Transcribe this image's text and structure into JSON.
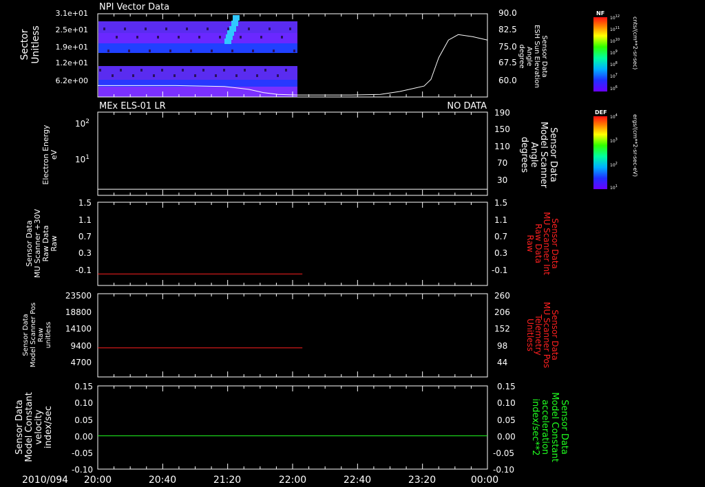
{
  "date_label": "2010/094",
  "time_ticks": [
    "20:00",
    "20:40",
    "21:20",
    "22:00",
    "22:40",
    "23:20",
    "00:00"
  ],
  "colorbars": [
    {
      "tag": "NF",
      "unit": "cnts/(cm**2-sr-sec)",
      "tick_exp": [
        "12",
        "11",
        "10",
        "9",
        "8",
        "7",
        "6"
      ]
    },
    {
      "tag": "DEF",
      "unit": "ergs/(cm**2-sr-sec-eV)",
      "tick_exp": [
        "4",
        "3",
        "2",
        "1"
      ]
    }
  ],
  "panel1": {
    "title": "NPI Vector Data",
    "left_label": [
      "Sector",
      "Unitless"
    ],
    "left_ticks": [
      "3.1e+01",
      "2.5e+01",
      "1.9e+01",
      "1.2e+01",
      "6.2e+00"
    ],
    "right_label": [
      "Sensor Data",
      "ESH Sun Elevation",
      "Angle",
      "degree"
    ],
    "right_ticks": [
      "90.0",
      "82.5",
      "75.0",
      "67.5",
      "60.0"
    ]
  },
  "panel2": {
    "title": "MEx ELS-01 LR",
    "status": "NO DATA",
    "left_label": [
      "Electron Energy",
      "eV"
    ],
    "left_ticks": [
      "10^2",
      "10^1"
    ],
    "right_label": [
      "Sensor Data",
      "Model Scanner",
      "Angle",
      "degrees"
    ],
    "right_ticks": [
      "190",
      "150",
      "110",
      "70",
      "30"
    ]
  },
  "panel3": {
    "left_label": [
      "Sensor Data",
      "MU Scanner +30V",
      "Raw Data",
      "Raw"
    ],
    "left_ticks": [
      "1.5",
      "1.1",
      "0.7",
      "0.3",
      "-0.1"
    ],
    "right_label": [
      "Sensor Data",
      "MU Scanner Int",
      "Raw Data",
      "Raw"
    ],
    "right_ticks": [
      "1.5",
      "1.1",
      "0.7",
      "0.3",
      "-0.1"
    ]
  },
  "panel4": {
    "left_label": [
      "Sensor Data",
      "Model Scanner Pos",
      "Raw",
      "unitless"
    ],
    "left_ticks": [
      "23500",
      "18800",
      "14100",
      "9400",
      "4700"
    ],
    "right_label": [
      "Sensor Data",
      "MU Scanner Pos",
      "Telemetry",
      "Unitless"
    ],
    "right_ticks": [
      "260",
      "206",
      "152",
      "98",
      "44"
    ]
  },
  "panel5": {
    "left_label": [
      "Sensor Data",
      "Model Constant",
      "velocity",
      "index/sec"
    ],
    "left_ticks": [
      "0.15",
      "0.10",
      "0.05",
      "0.00",
      "-0.05",
      "-0.10"
    ],
    "right_label": [
      "Sensor Data",
      "Model Constant",
      "acceleration",
      "index/sec**2"
    ],
    "right_ticks": [
      "0.15",
      "0.10",
      "0.05",
      "0.00",
      "-0.05",
      "-0.10"
    ]
  },
  "colors": {
    "white": "#ffffff",
    "red": "#ff2020",
    "green": "#20ff20",
    "bg": "#000000"
  },
  "chart_data": [
    {
      "type": "heatmap",
      "title": "NPI Vector Data",
      "xlabel": "",
      "x_range": [
        "20:00",
        "00:00"
      ],
      "data_extent": [
        "20:00",
        "22:03"
      ],
      "sector_rows_y_approx": [
        28.6,
        24.0,
        17.6,
        12.0,
        8.0
      ],
      "overlay_line": {
        "name": "ESH Sun Elevation Angle",
        "x_hours": [
          0,
          0.8,
          1.3,
          1.55,
          1.7,
          1.85,
          2.05,
          2.6,
          2.9,
          3.1,
          3.35,
          3.42,
          3.5,
          3.6,
          3.7,
          3.85,
          4.0
        ],
        "y_deg": [
          57.2,
          57.2,
          56.8,
          55.5,
          54.0,
          53.2,
          52.9,
          52.9,
          53.2,
          54.5,
          57.0,
          60.0,
          70.0,
          78.0,
          80.5,
          79.5,
          78.0
        ],
        "ylim": [
          52,
          90
        ]
      }
    },
    {
      "type": "line",
      "title": "MEx ELS-01 LR",
      "status": "NO DATA",
      "series": [
        {
          "y_axis": "Model Scanner Angle",
          "x_hours": [
            0,
            4.0
          ],
          "y_deg": [
            14.0,
            14.0
          ]
        }
      ],
      "ylim": [
        0,
        190
      ]
    },
    {
      "type": "line",
      "series": [
        {
          "y_axis": "MU Scanner +30V Raw",
          "x_hours": [
            0,
            2.1
          ],
          "y": [
            -0.05,
            -0.05
          ]
        }
      ],
      "ylim": [
        -0.3,
        1.5
      ]
    },
    {
      "type": "line",
      "series": [
        {
          "y_axis": "Model Scanner Pos Raw",
          "x_hours": [
            0,
            2.1
          ],
          "y": [
            8200,
            8200
          ]
        }
      ],
      "ylim": [
        0,
        23500
      ]
    },
    {
      "type": "line",
      "series": [
        {
          "y_axis": "Model Constant velocity",
          "x_hours": [
            0,
            4.0
          ],
          "y": [
            0.0,
            0.0
          ]
        }
      ],
      "ylim": [
        -0.1,
        0.15
      ]
    }
  ]
}
